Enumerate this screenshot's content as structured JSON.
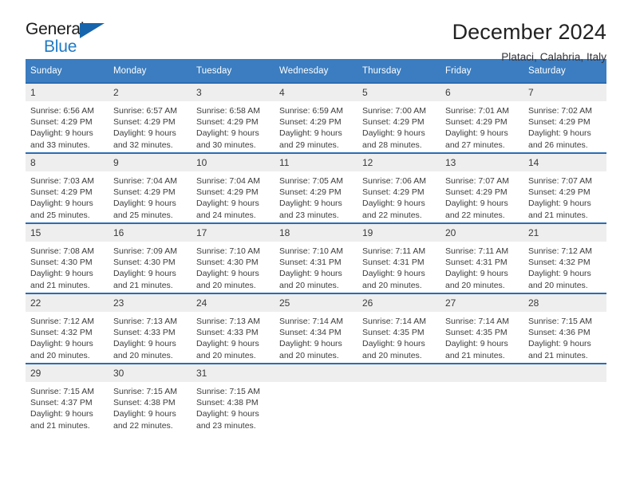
{
  "brand": {
    "name_part1": "General",
    "name_part2": "Blue",
    "flag_icon": "blue-triangle-flag"
  },
  "header": {
    "title": "December 2024",
    "location": "Plataci, Calabria, Italy"
  },
  "colors": {
    "header_blue": "#3b7dc0",
    "row_border_blue": "#2a6db3",
    "daynum_band": "#eeeeee",
    "brand_blue": "#1f7ac4",
    "flag_blue": "#1665ac",
    "text": "#3c3c3c"
  },
  "weekday_headers": [
    "Sunday",
    "Monday",
    "Tuesday",
    "Wednesday",
    "Thursday",
    "Friday",
    "Saturday"
  ],
  "weeks": [
    [
      {
        "day": "1",
        "sunrise": "Sunrise: 6:56 AM",
        "sunset": "Sunset: 4:29 PM",
        "daylight1": "Daylight: 9 hours",
        "daylight2": "and 33 minutes."
      },
      {
        "day": "2",
        "sunrise": "Sunrise: 6:57 AM",
        "sunset": "Sunset: 4:29 PM",
        "daylight1": "Daylight: 9 hours",
        "daylight2": "and 32 minutes."
      },
      {
        "day": "3",
        "sunrise": "Sunrise: 6:58 AM",
        "sunset": "Sunset: 4:29 PM",
        "daylight1": "Daylight: 9 hours",
        "daylight2": "and 30 minutes."
      },
      {
        "day": "4",
        "sunrise": "Sunrise: 6:59 AM",
        "sunset": "Sunset: 4:29 PM",
        "daylight1": "Daylight: 9 hours",
        "daylight2": "and 29 minutes."
      },
      {
        "day": "5",
        "sunrise": "Sunrise: 7:00 AM",
        "sunset": "Sunset: 4:29 PM",
        "daylight1": "Daylight: 9 hours",
        "daylight2": "and 28 minutes."
      },
      {
        "day": "6",
        "sunrise": "Sunrise: 7:01 AM",
        "sunset": "Sunset: 4:29 PM",
        "daylight1": "Daylight: 9 hours",
        "daylight2": "and 27 minutes."
      },
      {
        "day": "7",
        "sunrise": "Sunrise: 7:02 AM",
        "sunset": "Sunset: 4:29 PM",
        "daylight1": "Daylight: 9 hours",
        "daylight2": "and 26 minutes."
      }
    ],
    [
      {
        "day": "8",
        "sunrise": "Sunrise: 7:03 AM",
        "sunset": "Sunset: 4:29 PM",
        "daylight1": "Daylight: 9 hours",
        "daylight2": "and 25 minutes."
      },
      {
        "day": "9",
        "sunrise": "Sunrise: 7:04 AM",
        "sunset": "Sunset: 4:29 PM",
        "daylight1": "Daylight: 9 hours",
        "daylight2": "and 25 minutes."
      },
      {
        "day": "10",
        "sunrise": "Sunrise: 7:04 AM",
        "sunset": "Sunset: 4:29 PM",
        "daylight1": "Daylight: 9 hours",
        "daylight2": "and 24 minutes."
      },
      {
        "day": "11",
        "sunrise": "Sunrise: 7:05 AM",
        "sunset": "Sunset: 4:29 PM",
        "daylight1": "Daylight: 9 hours",
        "daylight2": "and 23 minutes."
      },
      {
        "day": "12",
        "sunrise": "Sunrise: 7:06 AM",
        "sunset": "Sunset: 4:29 PM",
        "daylight1": "Daylight: 9 hours",
        "daylight2": "and 22 minutes."
      },
      {
        "day": "13",
        "sunrise": "Sunrise: 7:07 AM",
        "sunset": "Sunset: 4:29 PM",
        "daylight1": "Daylight: 9 hours",
        "daylight2": "and 22 minutes."
      },
      {
        "day": "14",
        "sunrise": "Sunrise: 7:07 AM",
        "sunset": "Sunset: 4:29 PM",
        "daylight1": "Daylight: 9 hours",
        "daylight2": "and 21 minutes."
      }
    ],
    [
      {
        "day": "15",
        "sunrise": "Sunrise: 7:08 AM",
        "sunset": "Sunset: 4:30 PM",
        "daylight1": "Daylight: 9 hours",
        "daylight2": "and 21 minutes."
      },
      {
        "day": "16",
        "sunrise": "Sunrise: 7:09 AM",
        "sunset": "Sunset: 4:30 PM",
        "daylight1": "Daylight: 9 hours",
        "daylight2": "and 21 minutes."
      },
      {
        "day": "17",
        "sunrise": "Sunrise: 7:10 AM",
        "sunset": "Sunset: 4:30 PM",
        "daylight1": "Daylight: 9 hours",
        "daylight2": "and 20 minutes."
      },
      {
        "day": "18",
        "sunrise": "Sunrise: 7:10 AM",
        "sunset": "Sunset: 4:31 PM",
        "daylight1": "Daylight: 9 hours",
        "daylight2": "and 20 minutes."
      },
      {
        "day": "19",
        "sunrise": "Sunrise: 7:11 AM",
        "sunset": "Sunset: 4:31 PM",
        "daylight1": "Daylight: 9 hours",
        "daylight2": "and 20 minutes."
      },
      {
        "day": "20",
        "sunrise": "Sunrise: 7:11 AM",
        "sunset": "Sunset: 4:31 PM",
        "daylight1": "Daylight: 9 hours",
        "daylight2": "and 20 minutes."
      },
      {
        "day": "21",
        "sunrise": "Sunrise: 7:12 AM",
        "sunset": "Sunset: 4:32 PM",
        "daylight1": "Daylight: 9 hours",
        "daylight2": "and 20 minutes."
      }
    ],
    [
      {
        "day": "22",
        "sunrise": "Sunrise: 7:12 AM",
        "sunset": "Sunset: 4:32 PM",
        "daylight1": "Daylight: 9 hours",
        "daylight2": "and 20 minutes."
      },
      {
        "day": "23",
        "sunrise": "Sunrise: 7:13 AM",
        "sunset": "Sunset: 4:33 PM",
        "daylight1": "Daylight: 9 hours",
        "daylight2": "and 20 minutes."
      },
      {
        "day": "24",
        "sunrise": "Sunrise: 7:13 AM",
        "sunset": "Sunset: 4:33 PM",
        "daylight1": "Daylight: 9 hours",
        "daylight2": "and 20 minutes."
      },
      {
        "day": "25",
        "sunrise": "Sunrise: 7:14 AM",
        "sunset": "Sunset: 4:34 PM",
        "daylight1": "Daylight: 9 hours",
        "daylight2": "and 20 minutes."
      },
      {
        "day": "26",
        "sunrise": "Sunrise: 7:14 AM",
        "sunset": "Sunset: 4:35 PM",
        "daylight1": "Daylight: 9 hours",
        "daylight2": "and 20 minutes."
      },
      {
        "day": "27",
        "sunrise": "Sunrise: 7:14 AM",
        "sunset": "Sunset: 4:35 PM",
        "daylight1": "Daylight: 9 hours",
        "daylight2": "and 21 minutes."
      },
      {
        "day": "28",
        "sunrise": "Sunrise: 7:15 AM",
        "sunset": "Sunset: 4:36 PM",
        "daylight1": "Daylight: 9 hours",
        "daylight2": "and 21 minutes."
      }
    ],
    [
      {
        "day": "29",
        "sunrise": "Sunrise: 7:15 AM",
        "sunset": "Sunset: 4:37 PM",
        "daylight1": "Daylight: 9 hours",
        "daylight2": "and 21 minutes."
      },
      {
        "day": "30",
        "sunrise": "Sunrise: 7:15 AM",
        "sunset": "Sunset: 4:38 PM",
        "daylight1": "Daylight: 9 hours",
        "daylight2": "and 22 minutes."
      },
      {
        "day": "31",
        "sunrise": "Sunrise: 7:15 AM",
        "sunset": "Sunset: 4:38 PM",
        "daylight1": "Daylight: 9 hours",
        "daylight2": "and 23 minutes."
      },
      {
        "day": "",
        "sunrise": "",
        "sunset": "",
        "daylight1": "",
        "daylight2": ""
      },
      {
        "day": "",
        "sunrise": "",
        "sunset": "",
        "daylight1": "",
        "daylight2": ""
      },
      {
        "day": "",
        "sunrise": "",
        "sunset": "",
        "daylight1": "",
        "daylight2": ""
      },
      {
        "day": "",
        "sunrise": "",
        "sunset": "",
        "daylight1": "",
        "daylight2": ""
      }
    ]
  ]
}
